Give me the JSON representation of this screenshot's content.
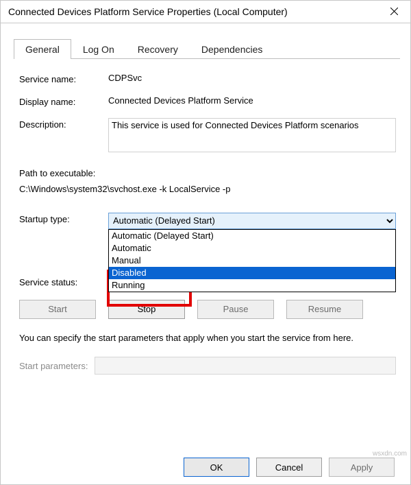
{
  "title": "Connected Devices Platform Service Properties (Local Computer)",
  "tabs": {
    "t0": "General",
    "t1": "Log On",
    "t2": "Recovery",
    "t3": "Dependencies"
  },
  "labels": {
    "service_name": "Service name:",
    "display_name": "Display name:",
    "description": "Description:",
    "path_label": "Path to executable:",
    "startup_type": "Startup type:",
    "service_status": "Service status:",
    "start_parameters": "Start parameters:"
  },
  "values": {
    "service_name": "CDPSvc",
    "display_name": "Connected Devices Platform Service",
    "description": "This service is used for Connected Devices Platform scenarios",
    "path": "C:\\Windows\\system32\\svchost.exe -k LocalService -p",
    "startup_selected": "Automatic (Delayed Start)",
    "service_status_value": "Running",
    "start_parameters_value": ""
  },
  "startup_options": {
    "o0": "Automatic (Delayed Start)",
    "o1": "Automatic",
    "o2": "Manual",
    "o3": "Disabled"
  },
  "buttons": {
    "start": "Start",
    "stop": "Stop",
    "pause": "Pause",
    "resume": "Resume",
    "ok": "OK",
    "cancel": "Cancel",
    "apply": "Apply"
  },
  "instruction": "You can specify the start parameters that apply when you start the service from here.",
  "watermark": "wsxdn.com"
}
